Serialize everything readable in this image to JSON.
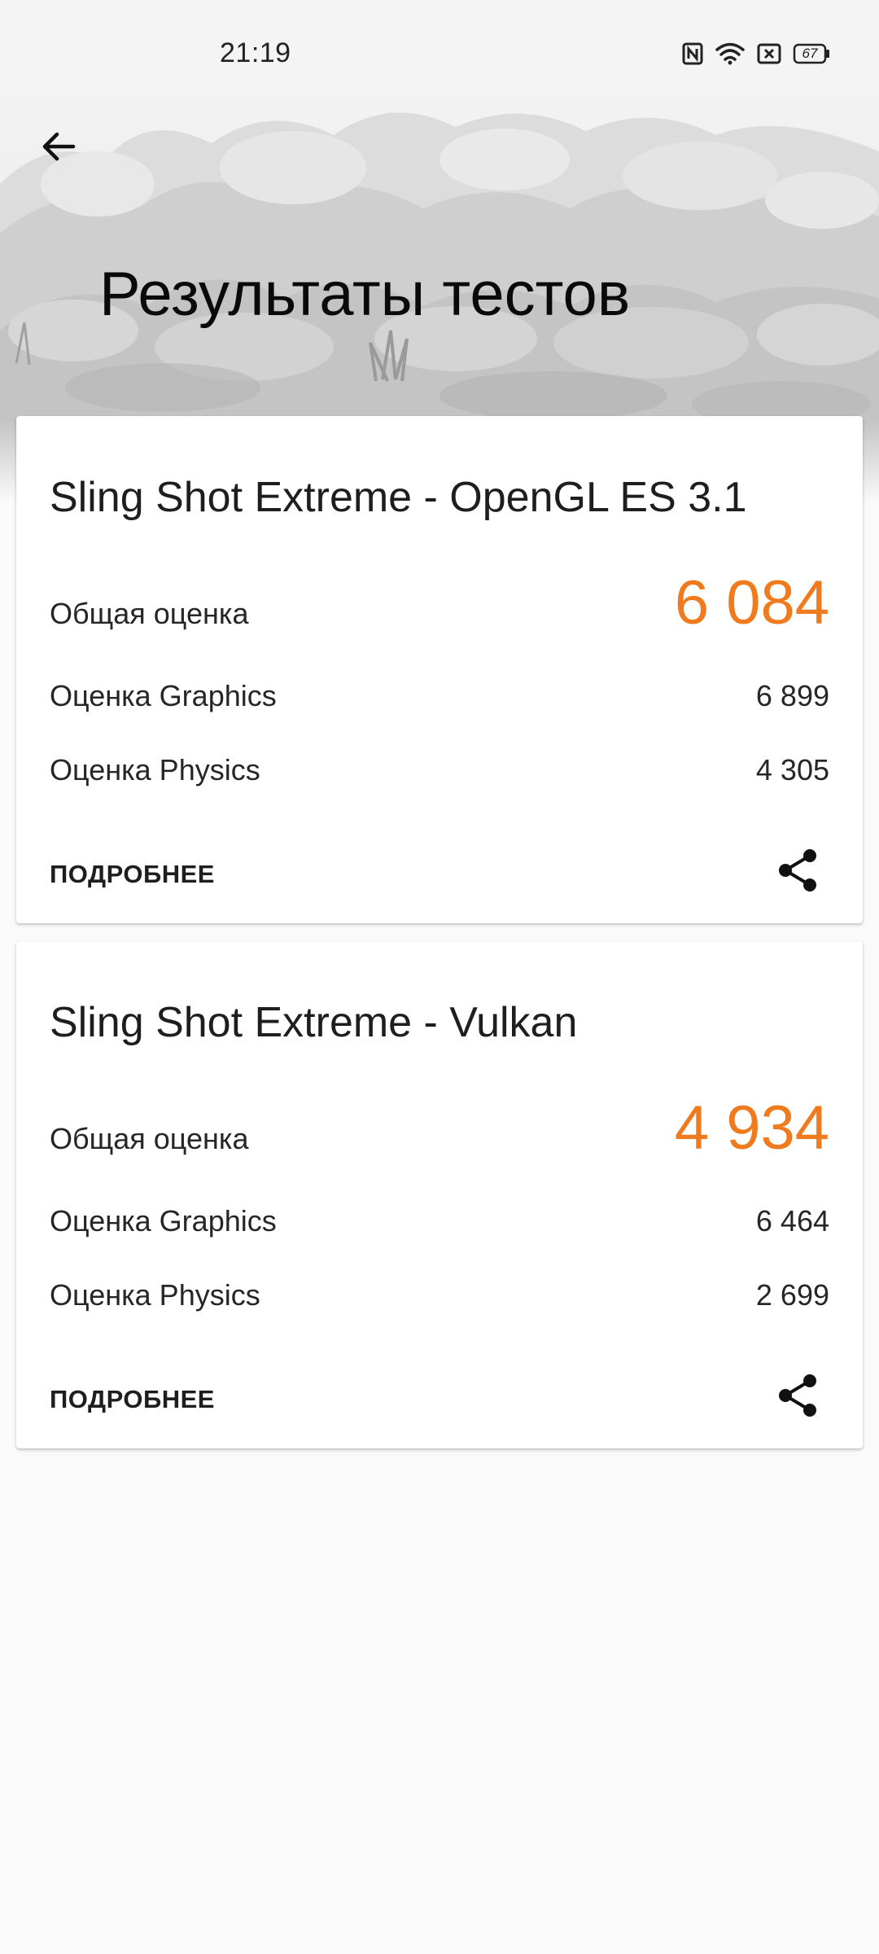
{
  "status_bar": {
    "time": "21:19",
    "battery_level": "67",
    "icons": [
      "nfc-icon",
      "wifi-icon",
      "sim-icon",
      "battery-icon"
    ]
  },
  "header": {
    "title": "Результаты тестов",
    "back_icon": "arrow-back-icon"
  },
  "results": [
    {
      "title": "Sling Shot Extreme - OpenGL ES 3.1",
      "overall_label": "Общая оценка",
      "overall_value": "6 084",
      "graphics_label": "Оценка Graphics",
      "graphics_value": "6 899",
      "physics_label": "Оценка Physics",
      "physics_value": "4 305",
      "details_label": "ПОДРОБНЕЕ",
      "share_icon": "share-icon"
    },
    {
      "title": "Sling Shot Extreme - Vulkan",
      "overall_label": "Общая оценка",
      "overall_value": "4 934",
      "graphics_label": "Оценка Graphics",
      "graphics_value": "6 464",
      "physics_label": "Оценка Physics",
      "physics_value": "2 699",
      "details_label": "ПОДРОБНЕЕ",
      "share_icon": "share-icon"
    }
  ],
  "colors": {
    "score_accent": "#f07a1e",
    "background": "#fafafa",
    "card": "#ffffff"
  }
}
